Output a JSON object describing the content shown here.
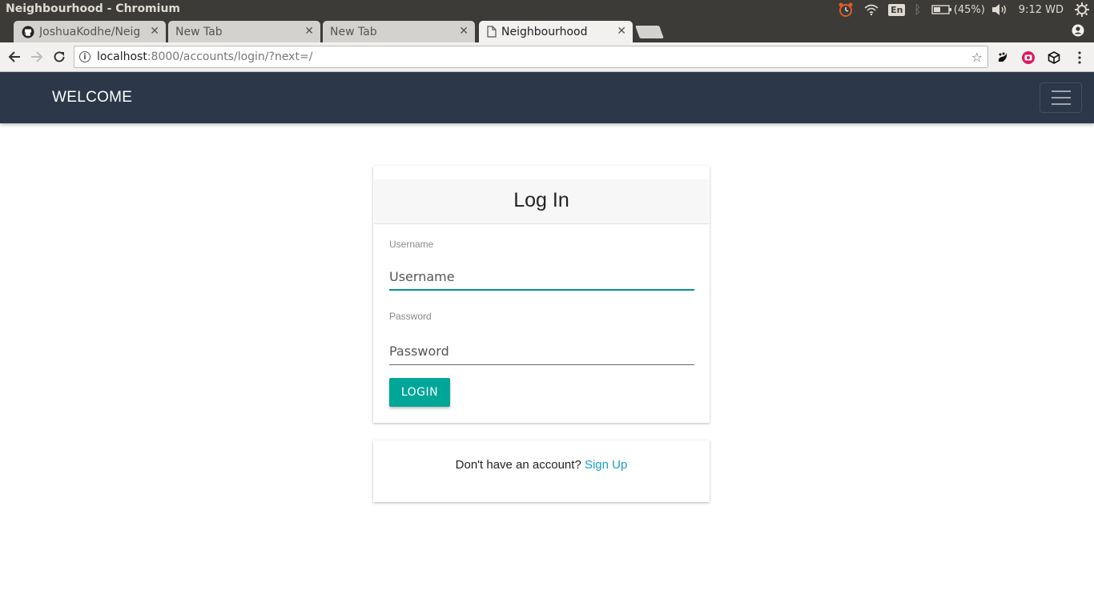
{
  "os": {
    "window_title": "Neighbourhood - Chromium",
    "language": "En",
    "battery": "(45%)",
    "clock": "9:12 WD"
  },
  "browser": {
    "tabs": [
      {
        "label": "JoshuaKodhe/Neig",
        "icon": "github-icon",
        "active": false
      },
      {
        "label": "New Tab",
        "icon": "",
        "active": false
      },
      {
        "label": "New Tab",
        "icon": "",
        "active": false
      },
      {
        "label": "Neighbourhood",
        "icon": "page-icon",
        "active": true
      }
    ],
    "url_host": "localhost",
    "url_rest": ":8000/accounts/login/?next=/"
  },
  "navbar": {
    "brand": "WELCOME",
    "bg_color": "#2c3749"
  },
  "login": {
    "title": "Log In",
    "username_label": "Username",
    "username_placeholder": "Username",
    "password_label": "Password",
    "password_placeholder": "Password",
    "button_label": "LOGIN",
    "accent_color": "#00a698"
  },
  "signup": {
    "prompt": "Don't have an account?",
    "link_label": "Sign Up"
  }
}
